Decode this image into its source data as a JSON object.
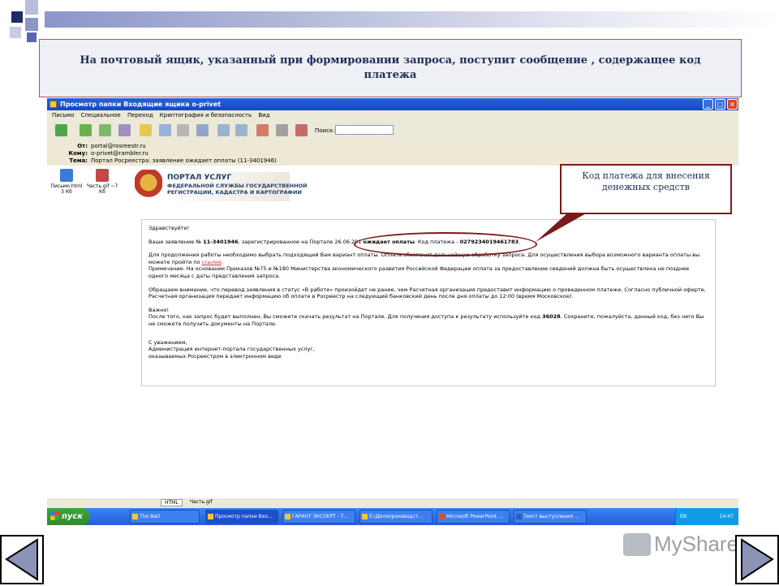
{
  "caption": "На почтовый ящик, указанный при формировании запроса, поступит сообщение , содержащее код платежа",
  "window": {
    "title": "Просмотр папки Входящие ящика o-privet",
    "menu": [
      "Письмо",
      "Специальное",
      "Переход",
      "Криптография и безопасность",
      "Вид"
    ],
    "search_label": "Поиск:",
    "search_value": ""
  },
  "header": {
    "from_label": "От:",
    "from_value": "portal@rosreestr.ru",
    "to_label": "Кому:",
    "to_value": "o-privet@rambler.ru",
    "subject_label": "Тема:",
    "subject_value": "Портал Росреестра: заявление ожидает оплаты (11-3401946)"
  },
  "attachments": [
    {
      "name": "Письмо.html 3 Кб"
    },
    {
      "name": "Часть.gif ~7 Кб"
    }
  ],
  "portal": {
    "title": "ПОРТАЛ УСЛУГ",
    "subtitle_1": "ФЕДЕРАЛЬНОЙ СЛУЖБЫ ГОСУДАРСТВЕННОЙ",
    "subtitle_2": "РЕГИСТРАЦИИ, КАДАСТРА И КАРТОГРАФИИ"
  },
  "mail": {
    "greeting": "Здравствуйте!",
    "line1_a": "Ваше заявление №",
    "line1_num": "11-3401946",
    "line1_b": ", зарегистрированное на Портале 26.06.201",
    "line1_status": "ожидает оплаты",
    "line1_c": ". Код платежа -",
    "payment_code": "0279234019461783",
    "p2": "Для продолжения работы необходимо выбрать подходящий Вам вариант оплаты. Оплата обеспечит дальнейшую обработку запроса. Для осуществления выбора возможного варианта оплаты вы можете пройти по",
    "p2_link": "ссылке",
    "p3": "Примечание: На основании Приказов №75 и №180 Министерства экономического развития Российской Федерации оплата за предоставление сведений должна быть осуществлена не позднее одного месяца с даты представления запроса.",
    "p4": "Обращаем внимание, что перевод заявления в статус «В работе» произойдет не ранее, чем Расчетная организация предоставит информацию о проведенном платеже. Согласно публичной оферте, Расчетная организация передает информацию об оплате в Росреестр на следующий банковский день после дня оплаты до 12:00 (время Московское).",
    "p5_title": "Важно!",
    "p5": "После того, как запрос будет выполнен, Вы сможете скачать результат на Портале. Для получения доступа к результату используйте код",
    "access_code": "36028",
    "p5_b": ". Сохраните, пожалуйста, данный код, без него Вы не сможете получить документы на Портале.",
    "sign1": "С уважением,",
    "sign2": "Администрация интернет-портала государственных услуг,",
    "sign3": "оказываемых Росреестром в электронном виде"
  },
  "tabs": {
    "html": "HTML",
    "gif": "Часть.gif"
  },
  "taskbar": {
    "start": "пуск",
    "items": [
      "The Bat!",
      "Просмотр папки Вхо...",
      "ГАРАНТ ЭКСПЕРТ - Т...",
      "E:\\Делопроизводст...",
      "Microsoft PowerPoint ...",
      "Текст выступления ..."
    ],
    "lang": "EN",
    "clock": "14:47"
  },
  "callout": "Код платежа для внесения денежных средств",
  "branding": "MyShared"
}
